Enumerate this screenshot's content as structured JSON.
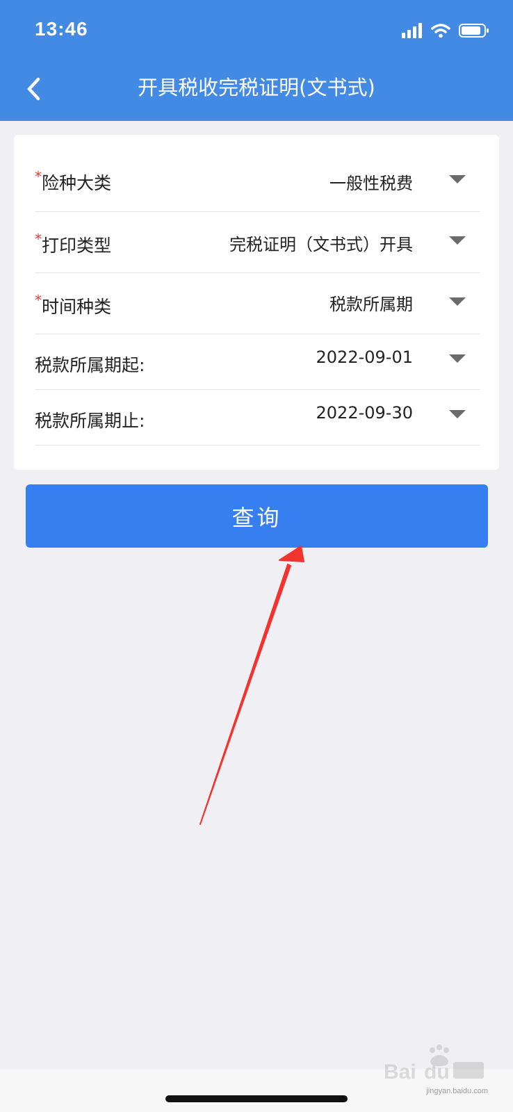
{
  "status_bar": {
    "time": "13:46"
  },
  "header": {
    "title": "开具税收完税证明(文书式)",
    "back_icon": "chevron-left-icon"
  },
  "form": {
    "fields": [
      {
        "label": "险种大类",
        "required": "*",
        "value": "一般性税费"
      },
      {
        "label": "打印类型",
        "required": "*",
        "value": "完税证明（文书式）开具"
      },
      {
        "label": "时间种类",
        "required": "*",
        "value": "税款所属期"
      },
      {
        "label": "税款所属期起:",
        "required": "",
        "value": "2022-09-01"
      },
      {
        "label": "税款所属期止:",
        "required": "",
        "value": "2022-09-30"
      }
    ]
  },
  "query_button": {
    "label": "查询"
  },
  "watermark": {
    "url": "jingyan.baidu.com"
  },
  "colors": {
    "header": "#438ae4",
    "button": "#377ef0",
    "required": "#e23a3a",
    "annotation_arrow": "#f2332e",
    "background": "#efeff4"
  }
}
